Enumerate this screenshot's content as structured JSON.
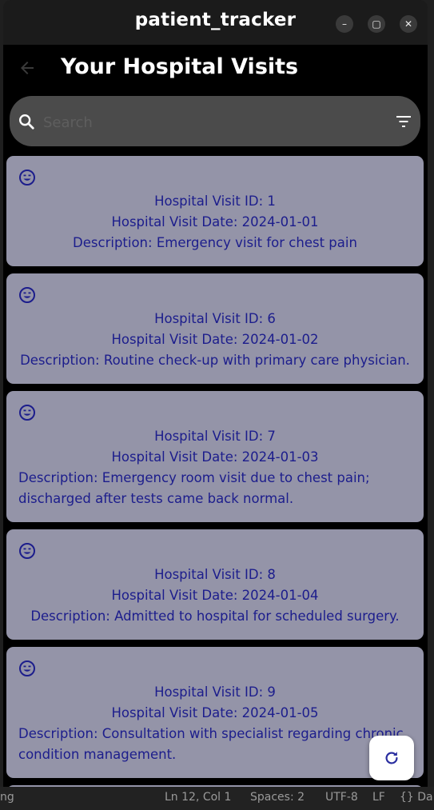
{
  "window": {
    "title": "patient_tracker",
    "minimize_glyph": "–",
    "maximize_glyph": "▢",
    "close_glyph": "✕"
  },
  "appbar": {
    "title": "Your Hospital Visits",
    "back_icon": "back-arrow-icon"
  },
  "search": {
    "placeholder": "Search",
    "value": "",
    "icons": [
      "search-icon",
      "filter-icon"
    ]
  },
  "visits": [
    {
      "id_text": "Hospital Visit ID: 1",
      "date_text": "Hospital Visit Date: 2024-01-01",
      "desc_text": "Description: Emergency visit for chest pain"
    },
    {
      "id_text": "Hospital Visit ID: 6",
      "date_text": "Hospital Visit Date: 2024-01-02",
      "desc_text": "Description: Routine check-up with primary care physician."
    },
    {
      "id_text": "Hospital Visit ID: 7",
      "date_text": "Hospital Visit Date: 2024-01-03",
      "desc_text": "Description: Emergency room visit due to chest pain; discharged after tests came back normal."
    },
    {
      "id_text": "Hospital Visit ID: 8",
      "date_text": "Hospital Visit Date: 2024-01-04",
      "desc_text": "Description: Admitted to hospital for scheduled surgery."
    },
    {
      "id_text": "Hospital Visit ID: 9",
      "date_text": "Hospital Visit Date: 2024-01-05",
      "desc_text": "Description: Consultation with specialist regarding chronic condition management."
    }
  ],
  "card_icon": "smiley-face-icon",
  "fab": {
    "icon": "refresh-icon"
  },
  "statusbar": {
    "left": "ng",
    "position": "Ln 12, Col 1",
    "spaces": "Spaces: 2",
    "encoding": "UTF-8",
    "eol": "LF",
    "lang": "{} Da"
  },
  "colors": {
    "card_bg": "#9494a8",
    "card_text": "#1c1d8c",
    "app_bg": "#000000",
    "search_bg": "#4b4b4b"
  }
}
